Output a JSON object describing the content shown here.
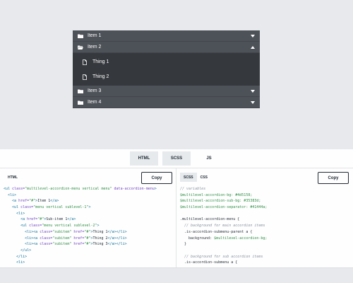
{
  "accordion": {
    "items": [
      {
        "label": "Item 1",
        "open": false
      },
      {
        "label": "Item 2",
        "open": true,
        "children": [
          "Thing 1",
          "Thing 2"
        ]
      },
      {
        "label": "Item 3",
        "open": false
      },
      {
        "label": "Item 4",
        "open": false
      }
    ],
    "colors": {
      "bg": "#4d5158",
      "sub_bg": "#35383d",
      "separator": "#44464d",
      "text": "#fefefe"
    }
  },
  "tabs": [
    "HTML",
    "SCSS",
    "JS"
  ],
  "html_panel": {
    "label": "HTML",
    "copy_label": "Copy",
    "lines": [
      [
        [
          "tok-tag",
          "<ul "
        ],
        [
          "tok-attr",
          "class="
        ],
        [
          "tok-str",
          "\"multilevel-accordion-menu vertical menu\""
        ],
        [
          "tok-attr",
          " data-accordion-menu"
        ],
        [
          "tok-tag",
          ">"
        ]
      ],
      [
        [
          "tok-txt",
          "  "
        ],
        [
          "tok-tag",
          "<li>"
        ]
      ],
      [
        [
          "tok-txt",
          "    "
        ],
        [
          "tok-tag",
          "<a "
        ],
        [
          "tok-attr",
          "href="
        ],
        [
          "tok-str",
          "\"#\""
        ],
        [
          "tok-tag",
          ">"
        ],
        [
          "tok-txt",
          "Item 1"
        ],
        [
          "tok-tag",
          "</a>"
        ]
      ],
      [
        [
          "tok-txt",
          "    "
        ],
        [
          "tok-tag",
          "<ul "
        ],
        [
          "tok-attr",
          "class="
        ],
        [
          "tok-str",
          "\"menu vertical sublevel-1\""
        ],
        [
          "tok-tag",
          ">"
        ]
      ],
      [
        [
          "tok-txt",
          "      "
        ],
        [
          "tok-tag",
          "<li>"
        ]
      ],
      [
        [
          "tok-txt",
          "        "
        ],
        [
          "tok-tag",
          "<a "
        ],
        [
          "tok-attr",
          "href="
        ],
        [
          "tok-str",
          "\"#\""
        ],
        [
          "tok-tag",
          ">"
        ],
        [
          "tok-txt",
          "Sub-item 1"
        ],
        [
          "tok-tag",
          "</a>"
        ]
      ],
      [
        [
          "tok-txt",
          "        "
        ],
        [
          "tok-tag",
          "<ul "
        ],
        [
          "tok-attr",
          "class="
        ],
        [
          "tok-str",
          "\"menu vertical sublevel-2\""
        ],
        [
          "tok-tag",
          ">"
        ]
      ],
      [
        [
          "tok-txt",
          "          "
        ],
        [
          "tok-tag",
          "<li><a "
        ],
        [
          "tok-attr",
          "class="
        ],
        [
          "tok-str",
          "\"subitem\""
        ],
        [
          "tok-attr",
          " href="
        ],
        [
          "tok-str",
          "\"#\""
        ],
        [
          "tok-tag",
          ">"
        ],
        [
          "tok-txt",
          "Thing 1"
        ],
        [
          "tok-tag",
          "</a></li>"
        ]
      ],
      [
        [
          "tok-txt",
          "          "
        ],
        [
          "tok-tag",
          "<li><a "
        ],
        [
          "tok-attr",
          "class="
        ],
        [
          "tok-str",
          "\"subitem\""
        ],
        [
          "tok-attr",
          " href="
        ],
        [
          "tok-str",
          "\"#\""
        ],
        [
          "tok-tag",
          ">"
        ],
        [
          "tok-txt",
          "Thing 2"
        ],
        [
          "tok-tag",
          "</a></li>"
        ]
      ],
      [
        [
          "tok-txt",
          "          "
        ],
        [
          "tok-tag",
          "<li><a "
        ],
        [
          "tok-attr",
          "class="
        ],
        [
          "tok-str",
          "\"subitem\""
        ],
        [
          "tok-attr",
          " href="
        ],
        [
          "tok-str",
          "\"#\""
        ],
        [
          "tok-tag",
          ">"
        ],
        [
          "tok-txt",
          "Thing 3"
        ],
        [
          "tok-tag",
          "</a></li>"
        ]
      ],
      [
        [
          "tok-txt",
          "        "
        ],
        [
          "tok-tag",
          "</ul>"
        ]
      ],
      [
        [
          "tok-txt",
          "      "
        ],
        [
          "tok-tag",
          "</li>"
        ]
      ],
      [
        [
          "tok-txt",
          "      "
        ],
        [
          "tok-tag",
          "<li>"
        ]
      ]
    ]
  },
  "scss_panel": {
    "subtabs": [
      "SCSS",
      "CSS"
    ],
    "copy_label": "Copy",
    "lines": [
      [
        [
          "tok-com",
          "// variables"
        ]
      ],
      [
        [
          "tok-var",
          "$multilevel-accordion-bg: #4d5158;"
        ]
      ],
      [
        [
          "tok-var",
          "$multilevel-accordion-sub-bg: #35383d;"
        ]
      ],
      [
        [
          "tok-var",
          "$multilevel-accordion-separator: #41444a;"
        ]
      ],
      [
        [
          "tok-txt",
          ""
        ]
      ],
      [
        [
          "tok-sel",
          ".multilevel-accordion-menu {"
        ]
      ],
      [
        [
          "tok-com",
          "  // background for main accordion items"
        ]
      ],
      [
        [
          "tok-sel",
          "  .is-accordion-submenu-parent a {"
        ]
      ],
      [
        [
          "tok-txt",
          "    background: "
        ],
        [
          "tok-var",
          "$multilevel-accordion-bg;"
        ]
      ],
      [
        [
          "tok-sel",
          "  }"
        ]
      ],
      [
        [
          "tok-txt",
          ""
        ]
      ],
      [
        [
          "tok-com",
          "  // background for sub accordion items"
        ]
      ],
      [
        [
          "tok-sel",
          "  .is-accordion-submenu a {"
        ]
      ]
    ]
  }
}
